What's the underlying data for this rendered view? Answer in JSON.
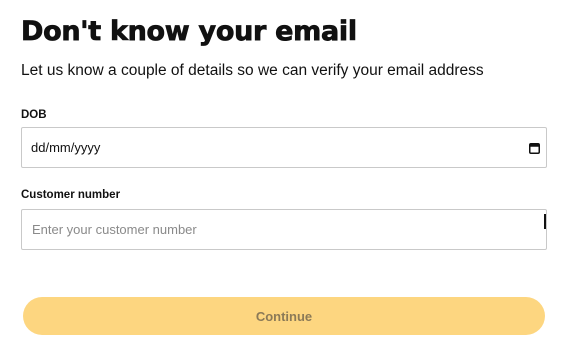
{
  "form": {
    "title": "Don't know your email",
    "subtitle": "Let us know a couple of details so we can verify your email address",
    "dob": {
      "label": "DOB",
      "value": "dd/mm/yyyy",
      "icon": "calendar-icon"
    },
    "customer_number": {
      "label": "Customer number",
      "placeholder": "Enter your customer number",
      "value": ""
    },
    "continue_label": "Continue"
  },
  "colors": {
    "button_background": "#fdd680",
    "button_text": "#8b7a57",
    "field_border": "#c9c9c9",
    "text": "#111111"
  }
}
